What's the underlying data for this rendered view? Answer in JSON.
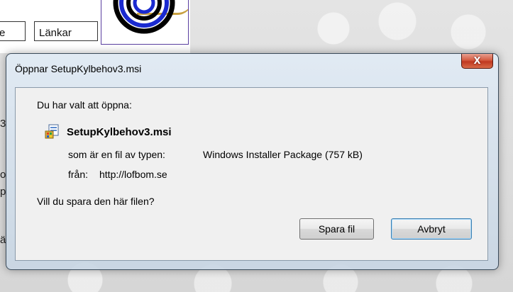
{
  "background": {
    "nav_left_label": "e",
    "nav_links_label": "Länkar",
    "side_chars": [
      "3",
      "o",
      "p",
      "ä"
    ]
  },
  "dialog": {
    "title": "Öppnar SetupKylbehov3.msi",
    "close_label": "X",
    "intro": "Du har valt att öppna:",
    "file_name": "SetupKylbehov3.msi",
    "file_icon": "msi-installer-icon",
    "type_key": "som är en fil av typen:",
    "type_value": "Windows Installer Package (757 kB)",
    "from_key": "från:",
    "from_value": "http://lofbom.se",
    "question": "Vill du spara den här filen?",
    "save_label": "Spara fil",
    "cancel_label": "Avbryt"
  },
  "colors": {
    "close_button": "#c03820",
    "focus_border": "#3c7fb1",
    "content_bg": "#f0f0f0"
  }
}
